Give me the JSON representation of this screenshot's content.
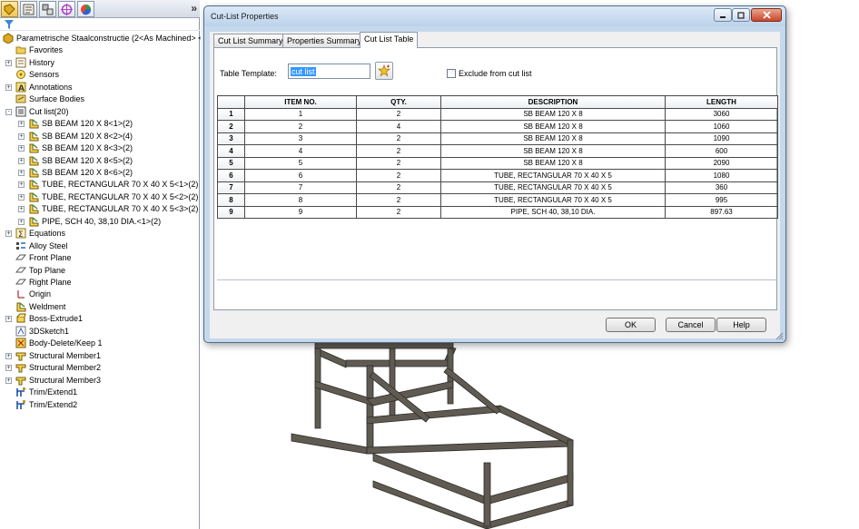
{
  "feature_tree": {
    "toolbar_icons": [
      "featuremanager-tree-icon",
      "property-manager-icon",
      "configuration-manager-icon",
      "dimxpert-icon",
      "display-manager-icon"
    ],
    "more_label": "»",
    "items": [
      {
        "label": "Parametrische Staalconstructie  (2<As Machined> <",
        "icon": "part-icon",
        "level": 0,
        "exp": ""
      },
      {
        "label": "Favorites",
        "icon": "folder-icon",
        "level": 1,
        "exp": ""
      },
      {
        "label": "History",
        "icon": "history-icon",
        "level": 1,
        "exp": "+"
      },
      {
        "label": "Sensors",
        "icon": "sensor-icon",
        "level": 1,
        "exp": ""
      },
      {
        "label": "Annotations",
        "icon": "annotation-icon",
        "level": 1,
        "exp": "+"
      },
      {
        "label": "Surface Bodies",
        "icon": "surface-bodies-icon",
        "level": 1,
        "exp": ""
      },
      {
        "label": "Cut list(20)",
        "icon": "cut-list-icon",
        "level": 1,
        "exp": "-"
      },
      {
        "label": "SB BEAM 120 X 8<1>(2)",
        "icon": "weldment-icon",
        "level": 2,
        "exp": "+"
      },
      {
        "label": "SB BEAM 120 X 8<2>(4)",
        "icon": "weldment-icon",
        "level": 2,
        "exp": "+"
      },
      {
        "label": "SB BEAM 120 X 8<3>(2)",
        "icon": "weldment-icon",
        "level": 2,
        "exp": "+"
      },
      {
        "label": "SB BEAM 120 X 8<5>(2)",
        "icon": "weldment-icon",
        "level": 2,
        "exp": "+"
      },
      {
        "label": "SB BEAM 120 X 8<6>(2)",
        "icon": "weldment-icon",
        "level": 2,
        "exp": "+"
      },
      {
        "label": "TUBE, RECTANGULAR 70 X 40 X 5<1>(2)",
        "icon": "weldment-icon",
        "level": 2,
        "exp": "+"
      },
      {
        "label": "TUBE, RECTANGULAR 70 X 40 X 5<2>(2)",
        "icon": "weldment-icon",
        "level": 2,
        "exp": "+"
      },
      {
        "label": "TUBE, RECTANGULAR 70 X 40 X 5<3>(2)",
        "icon": "weldment-icon",
        "level": 2,
        "exp": "+"
      },
      {
        "label": "PIPE, SCH 40, 38,10 DIA.<1>(2)",
        "icon": "weldment-icon",
        "level": 2,
        "exp": "+"
      },
      {
        "label": "Equations",
        "icon": "equations-icon",
        "level": 1,
        "exp": "+"
      },
      {
        "label": "Alloy Steel",
        "icon": "material-icon",
        "level": 1,
        "exp": ""
      },
      {
        "label": "Front Plane",
        "icon": "plane-icon",
        "level": 1,
        "exp": ""
      },
      {
        "label": "Top Plane",
        "icon": "plane-icon",
        "level": 1,
        "exp": ""
      },
      {
        "label": "Right Plane",
        "icon": "plane-icon",
        "level": 1,
        "exp": ""
      },
      {
        "label": "Origin",
        "icon": "origin-icon",
        "level": 1,
        "exp": ""
      },
      {
        "label": "Weldment",
        "icon": "weldment-icon",
        "level": 1,
        "exp": ""
      },
      {
        "label": "Boss-Extrude1",
        "icon": "extrude-icon",
        "level": 1,
        "exp": "+"
      },
      {
        "label": "3DSketch1",
        "icon": "sketch-3d-icon",
        "level": 1,
        "exp": ""
      },
      {
        "label": "Body-Delete/Keep 1",
        "icon": "body-delete-icon",
        "level": 1,
        "exp": ""
      },
      {
        "label": "Structural Member1",
        "icon": "structural-member-icon",
        "level": 1,
        "exp": "+"
      },
      {
        "label": "Structural Member2",
        "icon": "structural-member-icon",
        "level": 1,
        "exp": "+"
      },
      {
        "label": "Structural Member3",
        "icon": "structural-member-icon",
        "level": 1,
        "exp": "+"
      },
      {
        "label": "Trim/Extend1",
        "icon": "trim-extend-icon",
        "level": 1,
        "exp": ""
      },
      {
        "label": "Trim/Extend2",
        "icon": "trim-extend-icon",
        "level": 1,
        "exp": ""
      }
    ]
  },
  "dialog": {
    "title": "Cut-List Properties",
    "tabs": [
      "Cut List Summary",
      "Properties Summary",
      "Cut List Table"
    ],
    "active_tab": 2,
    "template_label": "Table Template:",
    "template_value": "cut list",
    "exclude_label": "Exclude from cut list",
    "exclude_checked": false,
    "table": {
      "columns": [
        "ITEM NO.",
        "QTY.",
        "DESCRIPTION",
        "LENGTH"
      ],
      "rows": [
        {
          "row": "1",
          "item": "1",
          "qty": "2",
          "description": "SB BEAM 120 X 8",
          "length": "3060"
        },
        {
          "row": "2",
          "item": "2",
          "qty": "4",
          "description": "SB BEAM 120 X 8",
          "length": "1060"
        },
        {
          "row": "3",
          "item": "3",
          "qty": "2",
          "description": "SB BEAM 120 X 8",
          "length": "1090"
        },
        {
          "row": "4",
          "item": "4",
          "qty": "2",
          "description": "SB BEAM 120 X 8",
          "length": "600"
        },
        {
          "row": "5",
          "item": "5",
          "qty": "2",
          "description": "SB BEAM 120 X 8",
          "length": "2090"
        },
        {
          "row": "6",
          "item": "6",
          "qty": "2",
          "description": "TUBE, RECTANGULAR 70 X 40 X 5",
          "length": "1080"
        },
        {
          "row": "7",
          "item": "7",
          "qty": "2",
          "description": "TUBE, RECTANGULAR 70 X 40 X 5",
          "length": "360"
        },
        {
          "row": "8",
          "item": "8",
          "qty": "2",
          "description": "TUBE, RECTANGULAR 70 X 40 X 5",
          "length": "995"
        },
        {
          "row": "9",
          "item": "9",
          "qty": "2",
          "description": "PIPE, SCH 40, 38,10 DIA.",
          "length": "897.63"
        }
      ]
    },
    "buttons": {
      "ok": "OK",
      "cancel": "Cancel",
      "help": "Help"
    }
  },
  "colors": {
    "dialog_frame": "#c6d8ec",
    "selection": "#3399ff",
    "steel": "#5f5a52"
  }
}
